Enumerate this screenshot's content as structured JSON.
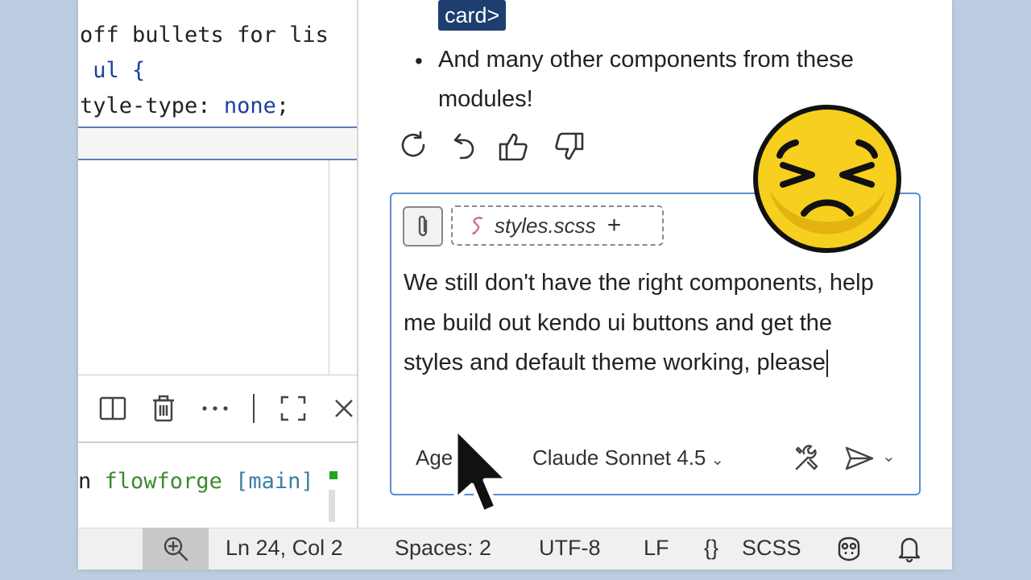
{
  "editor": {
    "lines": [
      "off bullets for lis",
      " ul {",
      "tyle-type: none;"
    ]
  },
  "terminal": {
    "prefix": "n",
    "repo": "flowforge",
    "branch": "[main]"
  },
  "chat": {
    "response_tag": "card>",
    "bullet_text": "And many other components from these modules!",
    "attachment_label": "styles.scss",
    "attachment_add": "+",
    "message": "We still don't have the right components, help me build out kendo ui buttons and get the styles and default theme working, please",
    "mode_label": "Age",
    "model_label": "Claude Sonnet 4.5"
  },
  "status_bar": {
    "position": "Ln 24, Col 2",
    "spaces": "Spaces: 2",
    "encoding": "UTF-8",
    "eol": "LF",
    "braces": "{}",
    "language": "SCSS"
  },
  "colors": {
    "accent": "#5a8fd1",
    "tag_bg": "#1d3f70",
    "terminal_green": "#3d8a2e",
    "emoji_yellow": "#f6cf1f"
  },
  "icons": [
    "retry-icon",
    "undo-icon",
    "thumbs-up-icon",
    "thumbs-down-icon",
    "paperclip-icon",
    "tools-icon",
    "send-icon",
    "bell-icon",
    "copilot-icon",
    "zoom-icon"
  ]
}
